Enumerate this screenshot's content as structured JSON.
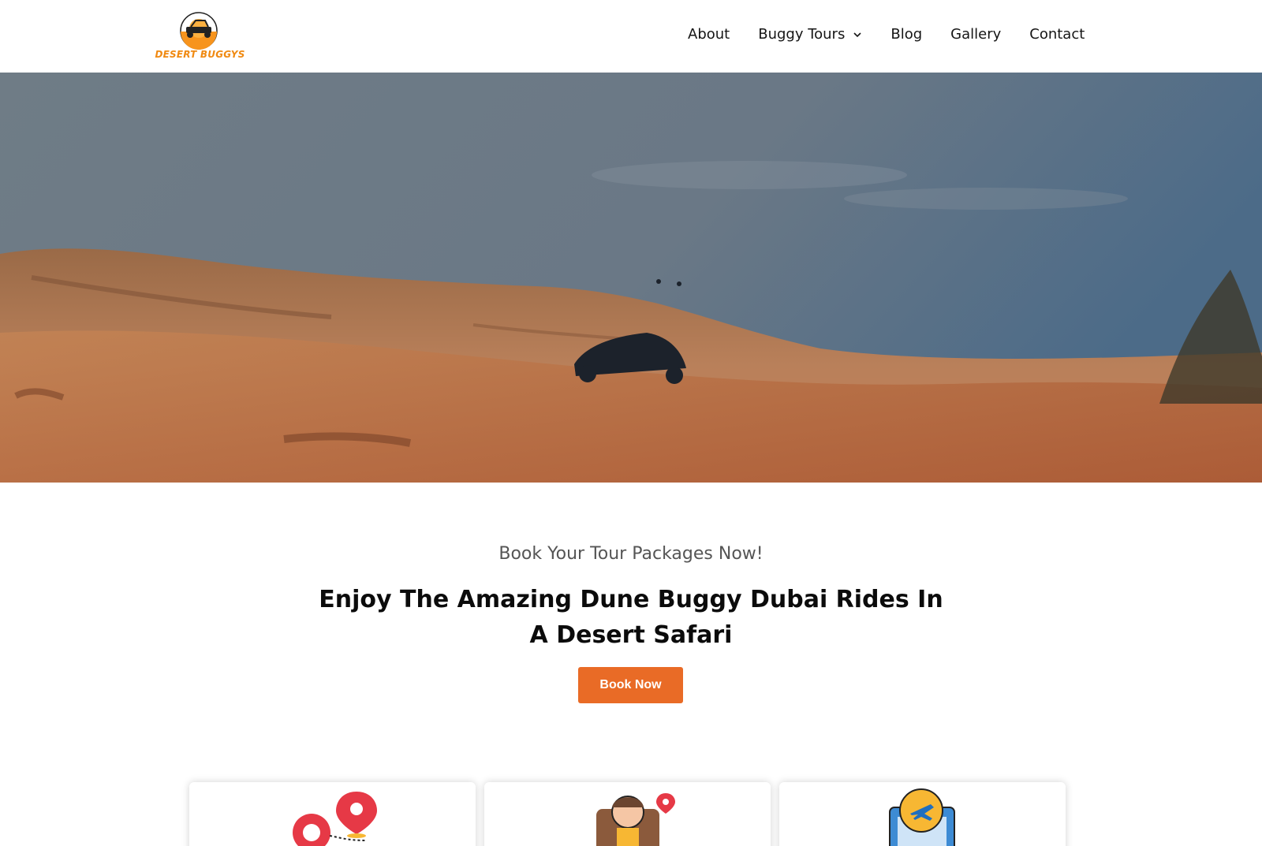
{
  "header": {
    "logo_text": "DESERT BUGGYS",
    "nav": [
      {
        "label": "About"
      },
      {
        "label": "Buggy Tours",
        "has_dropdown": true
      },
      {
        "label": "Blog"
      },
      {
        "label": "Gallery"
      },
      {
        "label": "Contact"
      }
    ]
  },
  "intro": {
    "subtitle": "Book Your Tour Packages Now!",
    "title": "Enjoy The Amazing Dune Buggy Dubai Rides In A Desert Safari",
    "cta_label": "Book Now"
  },
  "cards": [
    {
      "icon": "route-pin-icon"
    },
    {
      "icon": "traveler-backpack-icon"
    },
    {
      "icon": "airplane-booking-icon"
    }
  ],
  "colors": {
    "accent": "#e96b26",
    "logo_orange": "#f08a12"
  }
}
